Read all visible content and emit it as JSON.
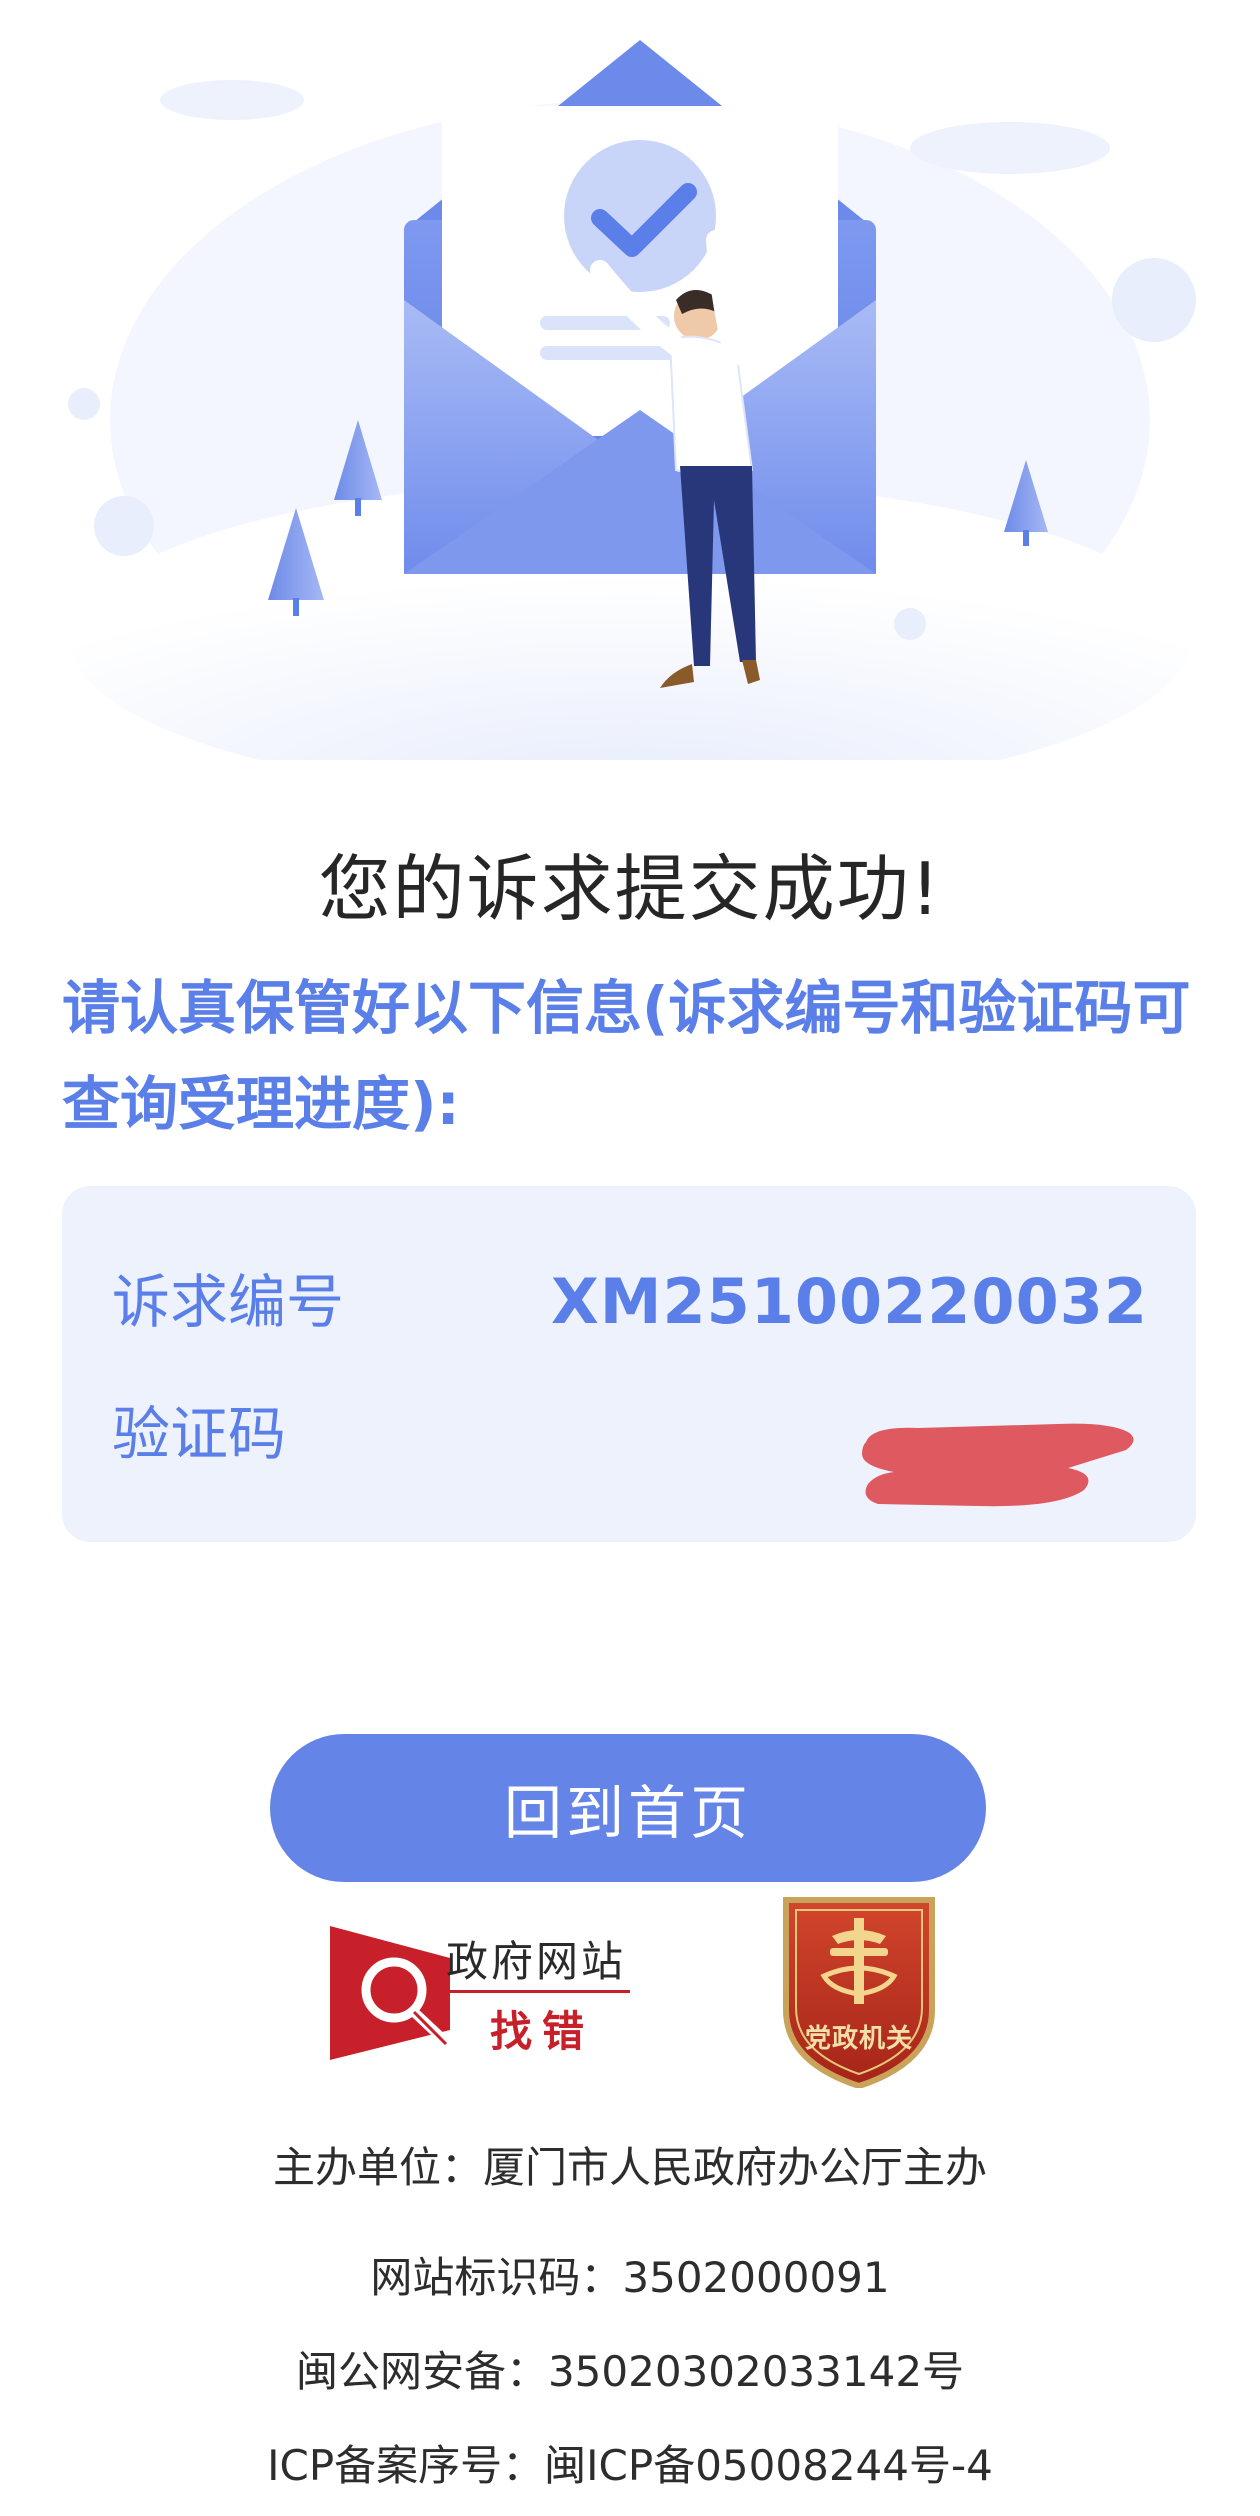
{
  "page": {
    "title": "您的诉求提交成功!",
    "notice": "请认真保管好以下信息(诉求编号和验证码可查询受理进度):"
  },
  "info": {
    "case_number_label": "诉求编号",
    "case_number_value": "XM25100220032",
    "verify_code_label": "验证码"
  },
  "actions": {
    "home_button": "回到首页"
  },
  "badges": {
    "gov_error_line1": "政府网站",
    "gov_error_line2": "找错",
    "party_gov_label": "党政机关"
  },
  "footer": {
    "sponsor": "主办单位：厦门市人民政府办公厅主办",
    "site_code": "网站标识码：3502000091",
    "police_record": "闽公网安备：35020302033142号",
    "icp_record": "ICP备案序号：闽ICP备05008244号-4"
  },
  "colors": {
    "accent": "#5b7fe8",
    "button": "#6484e8",
    "card_bg": "#eef2fc",
    "redaction": "#de5a60",
    "badge_red": "#c8202a"
  },
  "icons": {
    "hero": "envelope-success-illustration",
    "check": "check-icon",
    "error_badge": "magnifier-icon",
    "party_badge": "party-emblem-icon"
  }
}
